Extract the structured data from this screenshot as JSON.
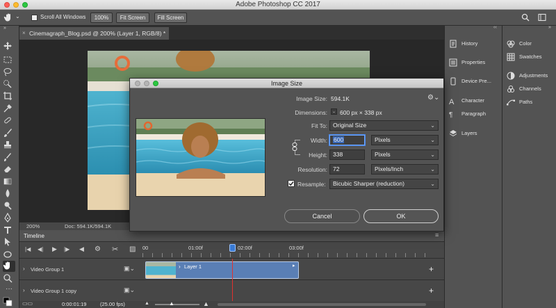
{
  "app": {
    "title": "Adobe Photoshop CC 2017"
  },
  "options_bar": {
    "scroll_all_windows_label": "Scroll All Windows",
    "scroll_all_windows_checked": false,
    "zoom_100_label": "100%",
    "fit_screen_label": "Fit Screen",
    "fill_screen_label": "Fill Screen"
  },
  "document": {
    "tab_label": "Cinemagraph_Blog.psd @ 200% (Layer 1, RGB/8) *"
  },
  "status": {
    "zoom": "200%",
    "doc_info": "Doc: 594.1K/594.1K"
  },
  "timeline": {
    "title": "Timeline",
    "ruler_labels": [
      "00",
      "01:00f",
      "02:00f",
      "03:00f"
    ],
    "tracks": [
      {
        "name": "Video Group 1",
        "clip_label": "Layer 1"
      },
      {
        "name": "Video Group 1 copy"
      }
    ],
    "current_time": "0:00:01:19",
    "fps": "(25.00 fps)"
  },
  "panels": {
    "col1": [
      "History",
      "Properties",
      "Device Pre...",
      "Character",
      "Paragraph",
      "Layers"
    ],
    "col2": [
      "Color",
      "Swatches",
      "Adjustments",
      "Channels",
      "Paths"
    ]
  },
  "dialog": {
    "title": "Image Size",
    "image_size_label": "Image Size:",
    "image_size_value": "594.1K",
    "dimensions_label": "Dimensions:",
    "dimensions_value": "600 px × 338 px",
    "fit_to_label": "Fit To:",
    "fit_to_value": "Original Size",
    "width_label": "Width:",
    "width_value": "600",
    "width_unit": "Pixels",
    "height_label": "Height:",
    "height_value": "338",
    "height_unit": "Pixels",
    "resolution_label": "Resolution:",
    "resolution_value": "72",
    "resolution_unit": "Pixels/Inch",
    "resample_label": "Resample:",
    "resample_checked": true,
    "resample_value": "Bicubic Sharper (reduction)",
    "cancel_label": "Cancel",
    "ok_label": "OK"
  }
}
